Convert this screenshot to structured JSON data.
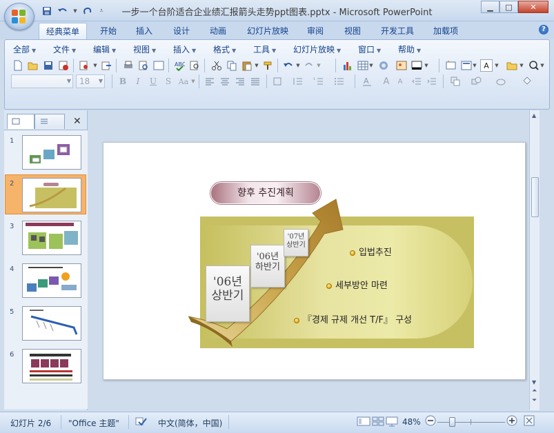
{
  "window": {
    "title": "一步一个台阶适合企业绩汇报箭头走势ppt图表.pptx - Microsoft PowerPoint"
  },
  "ribbon_tabs": [
    "经典菜单",
    "开始",
    "插入",
    "设计",
    "动画",
    "幻灯片放映",
    "审阅",
    "视图",
    "开发工具",
    "加载项"
  ],
  "menu": [
    {
      "label": "全部"
    },
    {
      "label": "文件"
    },
    {
      "label": "编辑"
    },
    {
      "label": "视图"
    },
    {
      "label": "插入"
    },
    {
      "label": "格式"
    },
    {
      "label": "工具"
    },
    {
      "label": "幻灯片放映"
    },
    {
      "label": "窗口"
    },
    {
      "label": "帮助"
    }
  ],
  "font_size_value": "18",
  "slides_panel": {
    "numbers": [
      "1",
      "2",
      "3",
      "4",
      "5",
      "6"
    ],
    "selected_index": 2
  },
  "slide": {
    "title": "향후 추진계획",
    "steps": [
      {
        "line1": "'06년",
        "line2": "상반기"
      },
      {
        "line1": "'06년",
        "line2": "하반기"
      },
      {
        "line1": "'07년",
        "line2": "상반기"
      }
    ],
    "bullets": [
      "입법추진",
      "세부방안 마련",
      "『경제 규제 개선 T/F』 구성"
    ]
  },
  "status": {
    "slide_indicator": "幻灯片 2/6",
    "theme": "\"Office 主题\"",
    "language": "中文(简体，中国)",
    "zoom": "48%"
  },
  "colors": {
    "accent_blue": "#15428b",
    "olive": "#c7c063",
    "title_pill": "#b58592",
    "selected_thumb": "#f6b36a"
  }
}
